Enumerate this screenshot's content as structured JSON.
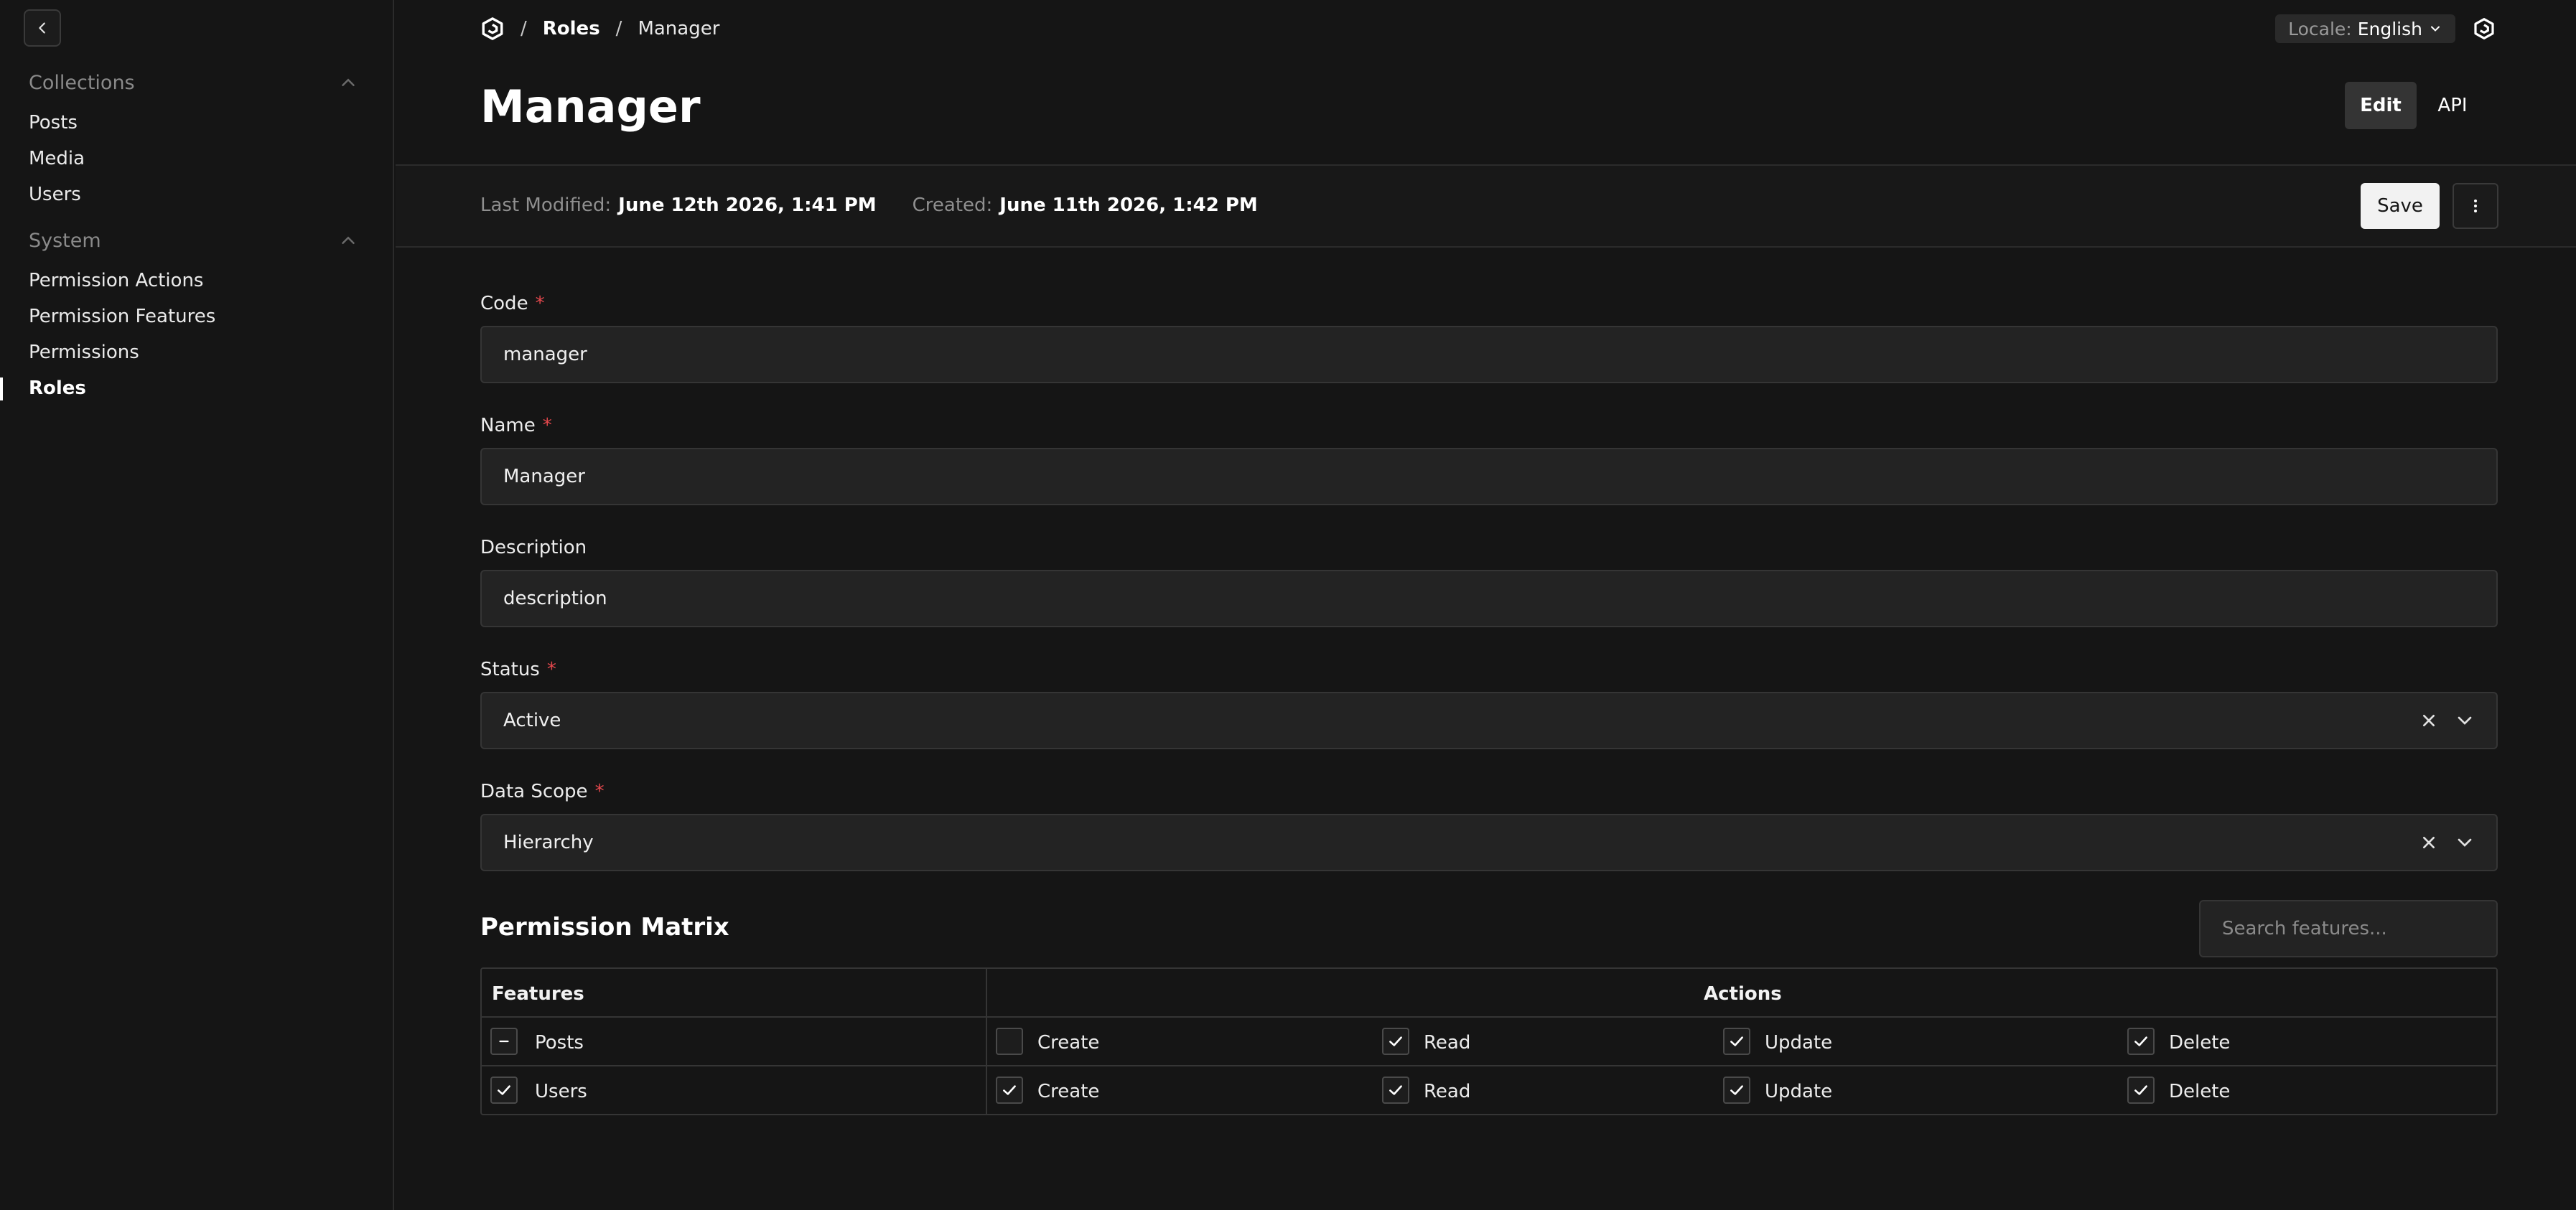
{
  "sidebar": {
    "groups": [
      {
        "title": "Collections",
        "items": [
          "Posts",
          "Media",
          "Users"
        ]
      },
      {
        "title": "System",
        "items": [
          "Permission Actions",
          "Permission Features",
          "Permissions",
          "Roles"
        ]
      }
    ],
    "active_item": "Roles"
  },
  "breadcrumb": {
    "sep1": "/",
    "roles": "Roles",
    "sep2": "/",
    "current": "Manager"
  },
  "locale": {
    "label": "Locale:",
    "value": "English"
  },
  "page": {
    "title": "Manager"
  },
  "view_tabs": {
    "edit": "Edit",
    "api": "API"
  },
  "meta": {
    "last_modified_label": "Last Modified:",
    "last_modified_value": "June 12th 2026, 1:41 PM",
    "created_label": "Created:",
    "created_value": "June 11th 2026, 1:42 PM"
  },
  "actions": {
    "save": "Save"
  },
  "form": {
    "code": {
      "label": "Code",
      "required": "*",
      "value": "manager"
    },
    "name": {
      "label": "Name",
      "required": "*",
      "value": "Manager"
    },
    "description": {
      "label": "Description",
      "value": "description"
    },
    "status": {
      "label": "Status",
      "required": "*",
      "value": "Active"
    },
    "data_scope": {
      "label": "Data Scope",
      "required": "*",
      "value": "Hierarchy"
    }
  },
  "matrix": {
    "title": "Permission Matrix",
    "search_placeholder": "Search features...",
    "headers": {
      "features": "Features",
      "actions": "Actions"
    },
    "rows": [
      {
        "feature": "Posts",
        "feature_state": "indeterminate",
        "actions": [
          {
            "label": "Create",
            "checked": false
          },
          {
            "label": "Read",
            "checked": true
          },
          {
            "label": "Update",
            "checked": true
          },
          {
            "label": "Delete",
            "checked": true
          }
        ]
      },
      {
        "feature": "Users",
        "feature_state": "checked",
        "actions": [
          {
            "label": "Create",
            "checked": true
          },
          {
            "label": "Read",
            "checked": true
          },
          {
            "label": "Update",
            "checked": true
          },
          {
            "label": "Delete",
            "checked": true
          }
        ]
      }
    ]
  },
  "colors": {
    "background": "#151515",
    "panel": "#232323",
    "border": "#353535",
    "required": "#e5484d"
  }
}
